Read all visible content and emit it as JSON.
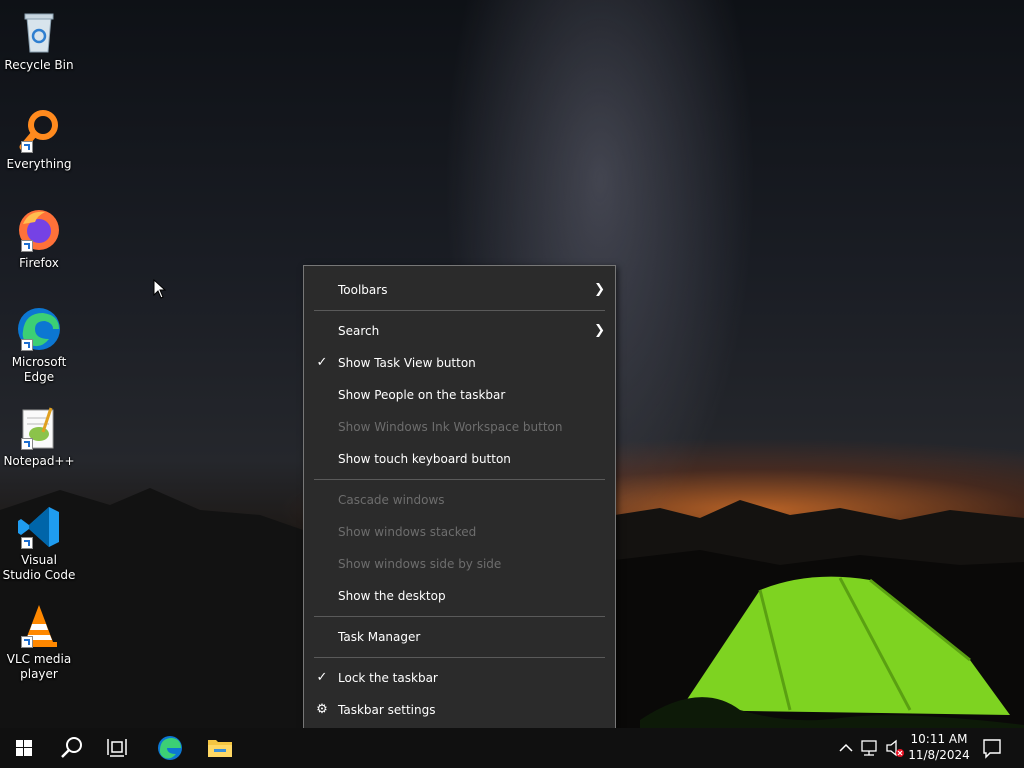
{
  "desktop": {
    "icons": [
      {
        "label": "Recycle Bin",
        "icon": "recycle-bin-icon"
      },
      {
        "label": "Everything",
        "icon": "everything-icon"
      },
      {
        "label": "Firefox",
        "icon": "firefox-icon"
      },
      {
        "label": "Microsoft Edge",
        "icon": "edge-icon"
      },
      {
        "label": "Notepad++",
        "icon": "notepad-plus-plus-icon"
      },
      {
        "label": "Visual Studio Code",
        "icon": "vscode-icon"
      },
      {
        "label": "VLC media player",
        "icon": "vlc-icon"
      }
    ]
  },
  "context_menu": {
    "toolbars": "Toolbars",
    "search": "Search",
    "show_task_view": "Show Task View button",
    "show_people": "Show People on the taskbar",
    "show_ink": "Show Windows Ink Workspace button",
    "show_touch_keyboard": "Show touch keyboard button",
    "cascade": "Cascade windows",
    "stacked": "Show windows stacked",
    "side_by_side": "Show windows side by side",
    "show_desktop": "Show the desktop",
    "task_manager": "Task Manager",
    "lock_taskbar": "Lock the taskbar",
    "taskbar_settings": "Taskbar settings"
  },
  "taskbar": {
    "time": "10:11 AM",
    "date": "11/8/2024"
  },
  "colors": {
    "menu_bg": "#2b2b2b",
    "menu_disabled": "#6d6d6d",
    "taskbar_bg": "#101010"
  }
}
